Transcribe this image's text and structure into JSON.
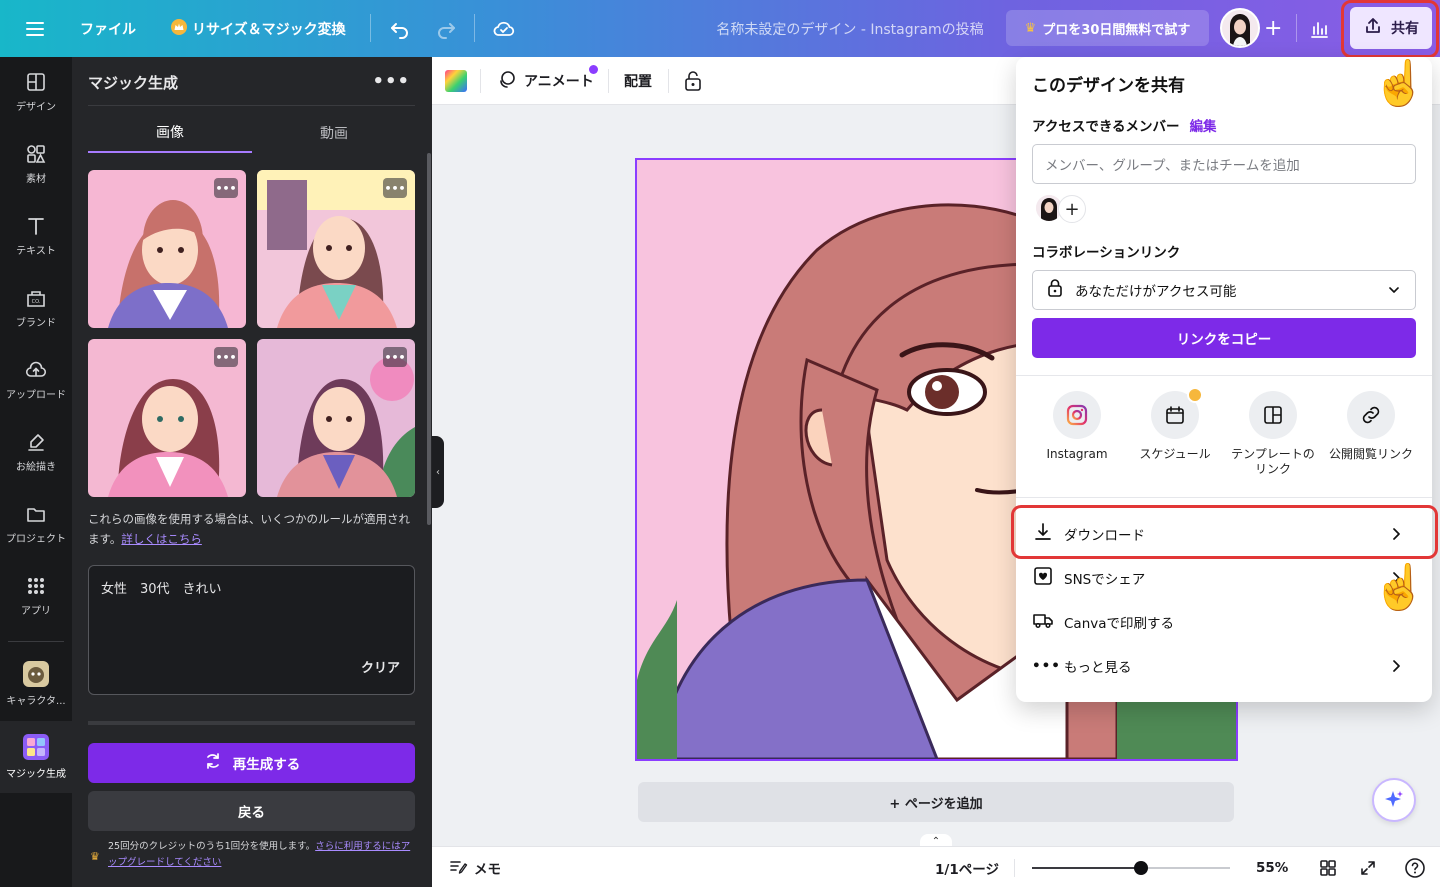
{
  "topbar": {
    "file_label": "ファイル",
    "resize_label": "リサイズ＆マジック変換",
    "doc_title": "名称未設定のデザイン - Instagramの投稿",
    "pro_label": "プロを30日間無料で試す",
    "share_label": "共有"
  },
  "rail": {
    "items": [
      {
        "label": "デザイン"
      },
      {
        "label": "素材"
      },
      {
        "label": "テキスト"
      },
      {
        "label": "ブランド"
      },
      {
        "label": "アップロード"
      },
      {
        "label": "お絵描き"
      },
      {
        "label": "プロジェクト"
      },
      {
        "label": "アプリ"
      },
      {
        "label": "キャラクタ..."
      },
      {
        "label": "マジック生成"
      }
    ]
  },
  "panel": {
    "title": "マジック生成",
    "tabs": [
      "画像",
      "動画"
    ],
    "rule_note": "これらの画像を使用する場合は、いくつかのルールが適用されます。",
    "rule_link": "詳しくはこちら",
    "prompt": "女性　30代　きれい",
    "clear_label": "クリア",
    "regenerate_label": "再生成する",
    "back_label": "戻る",
    "credit_note": "25回分のクレジットのうち1回分を使用します。",
    "credit_link": "さらに利用するにはアップグレードしてください"
  },
  "editor": {
    "animate_label": "アニメート",
    "arrange_label": "配置",
    "add_page_label": "+ ページを追加"
  },
  "footer": {
    "memo_label": "メモ",
    "page_label": "1/1ページ",
    "zoom_label": "55%",
    "zoom_value": 0.55
  },
  "share": {
    "title": "このデザインを共有",
    "members_label": "アクセスできるメンバー",
    "edit_label": "編集",
    "input_placeholder": "メンバー、グループ、またはチームを追加",
    "collab_label": "コラボレーションリンク",
    "access_value": "あなただけがアクセス可能",
    "copy_label": "リンクをコピー",
    "options": [
      {
        "label": "Instagram"
      },
      {
        "label": "スケジュール"
      },
      {
        "label": "テンプレートのリンク"
      },
      {
        "label": "公開閲覧リンク"
      }
    ],
    "rows": [
      {
        "label": "ダウンロード"
      },
      {
        "label": "SNSでシェア"
      },
      {
        "label": "Canvaで印刷する"
      },
      {
        "label": "もっと見る"
      }
    ]
  },
  "colors": {
    "accent": "#7d2ae8",
    "highlight": "#e23737"
  }
}
